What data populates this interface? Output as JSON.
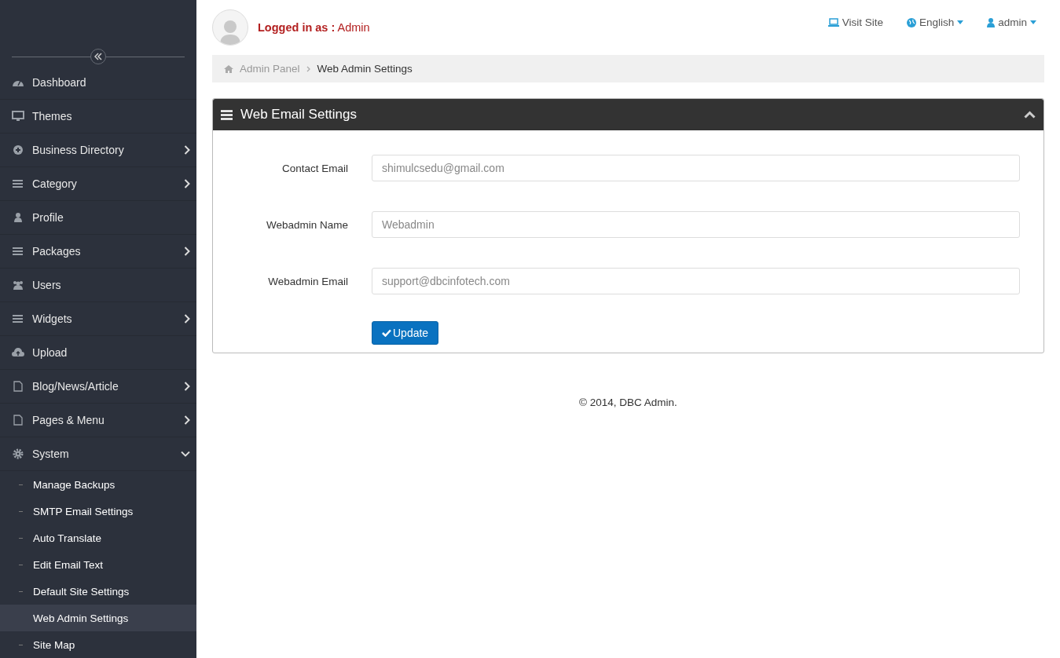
{
  "sidebar": {
    "items": [
      {
        "label": "Dashboard"
      },
      {
        "label": "Themes"
      },
      {
        "label": "Business Directory",
        "expanded": false
      },
      {
        "label": "Category",
        "expanded": false
      },
      {
        "label": "Profile"
      },
      {
        "label": "Packages",
        "expanded": false
      },
      {
        "label": "Users"
      },
      {
        "label": "Widgets",
        "expanded": false
      },
      {
        "label": "Upload"
      },
      {
        "label": "Blog/News/Article",
        "expanded": false
      },
      {
        "label": "Pages & Menu",
        "expanded": false
      },
      {
        "label": "System",
        "expanded": true,
        "children": [
          {
            "label": "Manage Backups",
            "selected": false
          },
          {
            "label": "SMTP Email Settings",
            "selected": false
          },
          {
            "label": "Auto Translate",
            "selected": false
          },
          {
            "label": "Edit Email Text",
            "selected": false
          },
          {
            "label": "Default Site Settings",
            "selected": false
          },
          {
            "label": "Web Admin Settings",
            "selected": true
          },
          {
            "label": "Site Map",
            "selected": false
          }
        ]
      }
    ]
  },
  "header": {
    "logged_in_label": "Logged in as :",
    "user": "Admin",
    "links": [
      {
        "kind": "visit",
        "label": "Visit Site",
        "dropdown": false
      },
      {
        "kind": "language",
        "label": "English",
        "dropdown": true
      },
      {
        "kind": "account",
        "label": "admin",
        "dropdown": true
      }
    ]
  },
  "breadcrumb": [
    {
      "label": "Admin Panel",
      "current": false
    },
    {
      "label": "Web Admin Settings",
      "current": true
    }
  ],
  "panel": {
    "title": "Web Email Settings",
    "fields": [
      {
        "label": "Contact Email",
        "value": "shimulcsedu@gmail.com"
      },
      {
        "label": "Webadmin Name",
        "value": "Webadmin"
      },
      {
        "label": "Webadmin Email",
        "value": "support@dbcinfotech.com"
      }
    ],
    "button": "Update"
  },
  "footer": "© 2014, DBC Admin."
}
